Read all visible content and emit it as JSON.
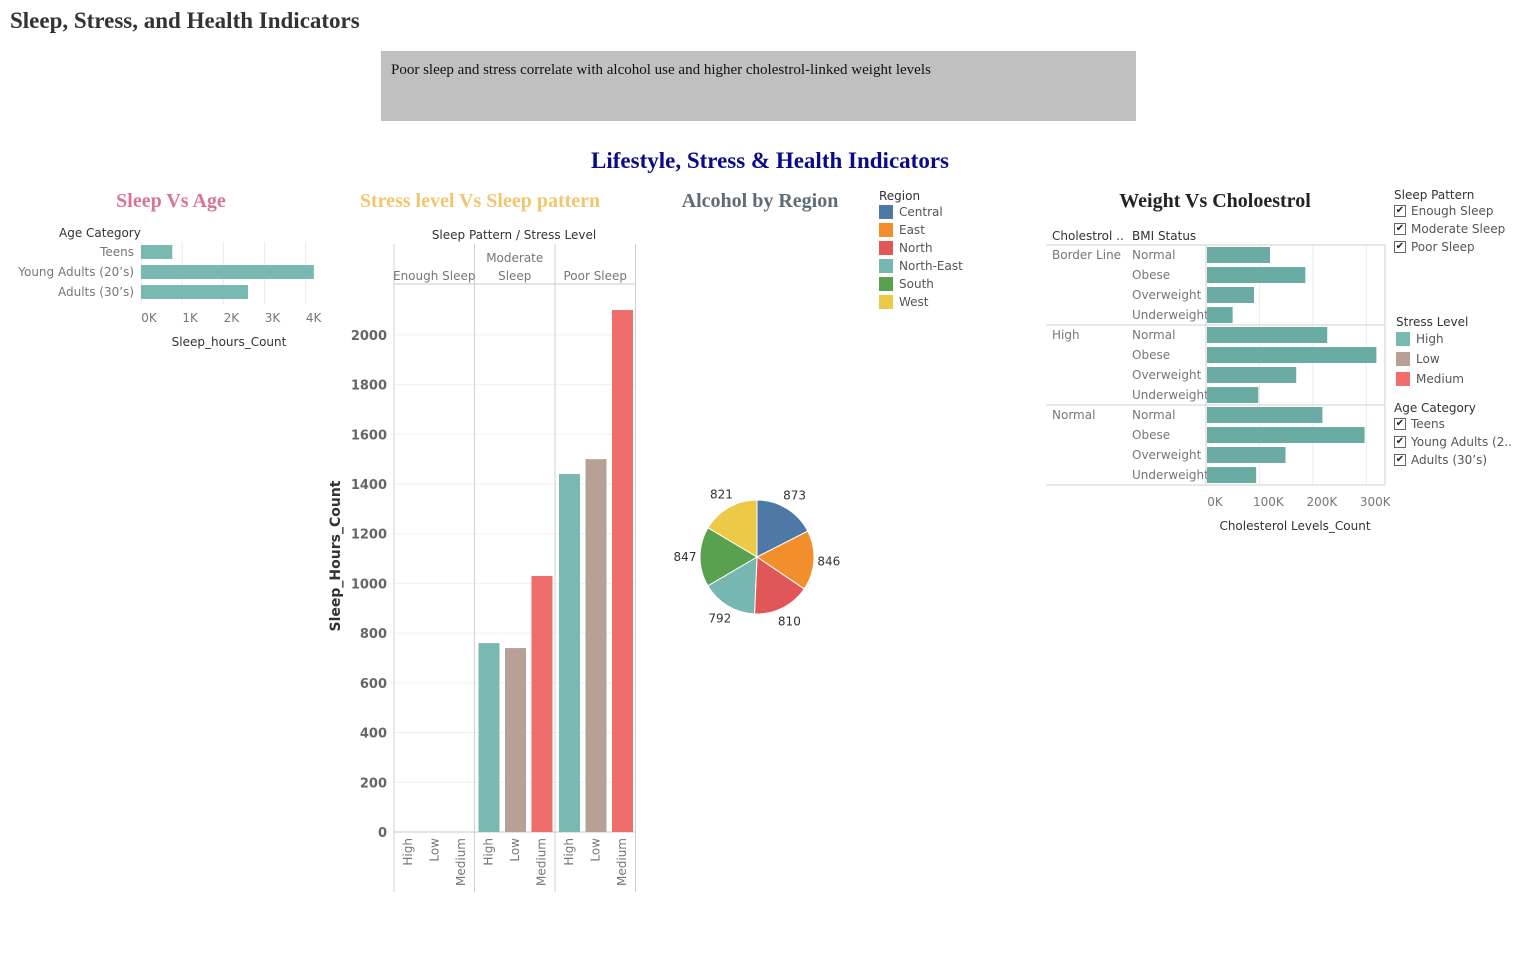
{
  "dashboard_title": "Sleep, Stress, and Health Indicators",
  "note_text": "Poor sleep and stress correlate with alcohol use and higher cholestrol-linked weight levels",
  "main_title": "Lifestyle, Stress & Health Indicators",
  "colors": {
    "teal": "#7ab8b2",
    "brown": "#b9a096",
    "red": "#ef6d6a",
    "teal_dark": "#6aaba4",
    "title_pink": "#d9739a",
    "title_yellow": "#f2c66d",
    "title_gray": "#5f6b75",
    "title_navy": "#0b0b8a"
  },
  "chart_data": [
    {
      "id": "sleep_vs_age",
      "type": "bar",
      "orientation": "horizontal",
      "title": "Sleep Vs Age",
      "row_header": "Age Category",
      "categories": [
        "Teens",
        "Young Adults (20’s)",
        "Adults (30’s)"
      ],
      "values": [
        760,
        4200,
        2600
      ],
      "xlabel": "Sleep_hours_Count",
      "xlim": [
        0,
        4300
      ],
      "x_ticks": [
        0,
        1000,
        2000,
        3000,
        4000
      ],
      "x_tick_labels": [
        "0K",
        "1K",
        "2K",
        "3K",
        "4K"
      ],
      "grid": true
    },
    {
      "id": "stress_vs_sleep",
      "type": "bar",
      "title": "Stress level Vs Sleep pattern",
      "column_header": "Sleep Pattern  /  Stress Level",
      "panels": [
        "Enough Sleep",
        "Moderate Sleep",
        "Poor Sleep"
      ],
      "categories": [
        "High",
        "Low",
        "Medium"
      ],
      "values": [
        [
          0,
          0,
          0
        ],
        [
          760,
          740,
          1030
        ],
        [
          1440,
          1500,
          2100
        ]
      ],
      "ylabel": "Sleep_Hours_Count",
      "ylim": [
        0,
        2100
      ],
      "y_ticks": [
        0,
        200,
        400,
        600,
        800,
        1000,
        1200,
        1400,
        1600,
        1800,
        2000
      ],
      "grid": true
    },
    {
      "id": "alcohol_by_region",
      "type": "pie",
      "title": "Alcohol by Region",
      "legend_title": "Region",
      "legend_position": "right",
      "labels": [
        "Central",
        "East",
        "North",
        "North-East",
        "South",
        "West"
      ],
      "values": [
        873,
        846,
        810,
        792,
        847,
        821
      ],
      "colors": [
        "#4e79a7",
        "#f28e2b",
        "#e15759",
        "#76b7b2",
        "#59a14f",
        "#edc948"
      ]
    },
    {
      "id": "weight_vs_cholesterol",
      "type": "bar",
      "orientation": "horizontal",
      "title": "Weight Vs Choloestrol",
      "row_headers": [
        "Cholestrol ..",
        "BMI Status"
      ],
      "groups": [
        {
          "name": "Border Line",
          "categories": [
            "Normal",
            "Obese",
            "Overweight",
            "Underweight"
          ],
          "values": [
            118000,
            184000,
            88000,
            48000
          ]
        },
        {
          "name": "High",
          "categories": [
            "Normal",
            "Obese",
            "Overweight",
            "Underweight"
          ],
          "values": [
            225000,
            317000,
            167000,
            96000
          ]
        },
        {
          "name": "Normal",
          "categories": [
            "Normal",
            "Obese",
            "Overweight",
            "Underweight"
          ],
          "values": [
            216000,
            295000,
            147000,
            92000
          ]
        }
      ],
      "xlabel": "Cholesterol Levels_Count",
      "xlim": [
        0,
        335000
      ],
      "x_ticks": [
        0,
        100000,
        200000,
        300000
      ],
      "x_tick_labels": [
        "0K",
        "100K",
        "200K",
        "300K"
      ],
      "grid": true
    }
  ],
  "filters": {
    "sleep_pattern": {
      "title": "Sleep Pattern",
      "options": [
        "Enough Sleep",
        "Moderate Sleep",
        "Poor Sleep"
      ],
      "check_mark": "✔"
    },
    "stress_level": {
      "title": "Stress Level",
      "items": [
        {
          "label": "High",
          "color": "#7ab8b2"
        },
        {
          "label": "Low",
          "color": "#b9a096"
        },
        {
          "label": "Medium",
          "color": "#ef6d6a"
        }
      ]
    },
    "age_category": {
      "title": "Age Category",
      "options": [
        "Teens",
        "Young Adults (2..",
        "Adults (30’s)"
      ],
      "check_mark": "✔"
    }
  }
}
